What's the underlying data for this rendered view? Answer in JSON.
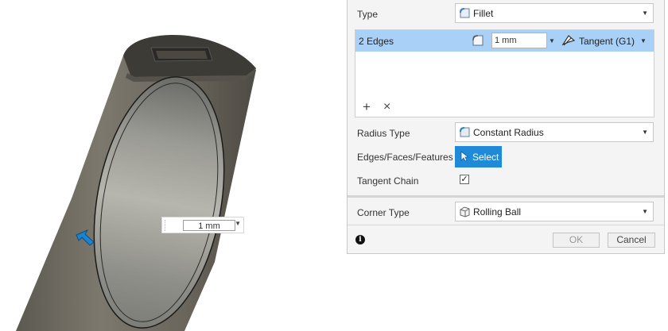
{
  "canvas": {
    "inline_dimension_value": "1 mm"
  },
  "panel": {
    "type": {
      "label": "Type",
      "value": "Fillet"
    },
    "edges": {
      "selection": "2 Edges",
      "radius": "1 mm",
      "tangency": "Tangent (G1)"
    },
    "radius_type": {
      "label": "Radius Type",
      "value": "Constant Radius"
    },
    "edges_faces_features": {
      "label": "Edges/Faces/Features",
      "button": "Select"
    },
    "tangent_chain": {
      "label": "Tangent Chain",
      "checked": true,
      "mark": "✓"
    },
    "corner_type": {
      "label": "Corner Type",
      "value": "Rolling Ball"
    },
    "ok_label": "OK",
    "cancel_label": "Cancel"
  },
  "icons": [
    "fillet-icon",
    "tangent-icon",
    "radius-type-icon",
    "cursor-icon",
    "rolling-ball-icon",
    "info-icon",
    "plus-icon",
    "close-icon",
    "chevron-down-icon",
    "manipulator-arrow-icon"
  ],
  "colors": {
    "selection_row": "#a9d1f7",
    "select_button": "#1f8bd8",
    "body_metal": "#6f6a60"
  }
}
